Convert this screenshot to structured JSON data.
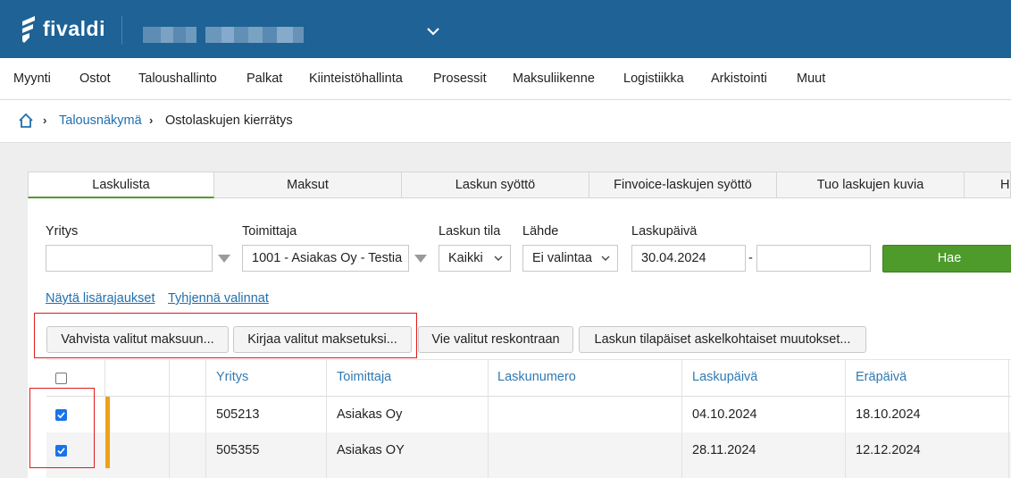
{
  "brand": {
    "name": "fivaldi"
  },
  "colors": {
    "header": "#1e6296",
    "accent_link": "#1f6fae",
    "primary_button": "#4e9a2b",
    "status_bar": "#f0a01b",
    "highlight": "#e01b1b"
  },
  "main_menu": [
    "Myynti",
    "Ostot",
    "Taloushallinto",
    "Palkat",
    "Kiinteistöhallinta",
    "Prosessit",
    "Maksuliikenne",
    "Logistiikka",
    "Arkistointi",
    "Muut"
  ],
  "breadcrumb": {
    "link": "Talousnäkymä",
    "current": "Ostolaskujen kierrätys"
  },
  "tabs": [
    "Laskulista",
    "Maksut",
    "Laskun syöttö",
    "Finvoice-laskujen syöttö",
    "Tuo laskujen kuvia",
    "H"
  ],
  "filters": {
    "yritys_label": "Yritys",
    "yritys_value": "",
    "toimittaja_label": "Toimittaja",
    "toimittaja_value": "1001 - Asiakas Oy - Testia",
    "tila_label": "Laskun tila",
    "tila_value": "Kaikki",
    "lahde_label": "Lähde",
    "lahde_value": "Ei valintaa",
    "pvm_label": "Laskupäivä",
    "pvm_from": "30.04.2024",
    "pvm_dash": "-",
    "pvm_to": "",
    "search_button": "Hae"
  },
  "links": {
    "show_more": "Näytä lisärajaukset",
    "clear": "Tyhjennä valinnat"
  },
  "actions": [
    "Vahvista valitut maksuun...",
    "Kirjaa valitut maksetuksi...",
    "Vie valitut reskontraan",
    "Laskun tilapäiset askelkohtaiset muutokset..."
  ],
  "table": {
    "columns": [
      "Yritys",
      "Toimittaja",
      "Laskunumero",
      "Laskupäivä",
      "Eräpäivä"
    ],
    "rows": [
      {
        "checked": true,
        "yritys": "505213",
        "toimittaja": "Asiakas Oy",
        "laskunumero": "",
        "laskupaiva": "04.10.2024",
        "erapaiva": "18.10.2024"
      },
      {
        "checked": true,
        "yritys": "505355",
        "toimittaja": "Asiakas OY",
        "laskunumero": "",
        "laskupaiva": "28.11.2024",
        "erapaiva": "12.12.2024"
      }
    ]
  }
}
